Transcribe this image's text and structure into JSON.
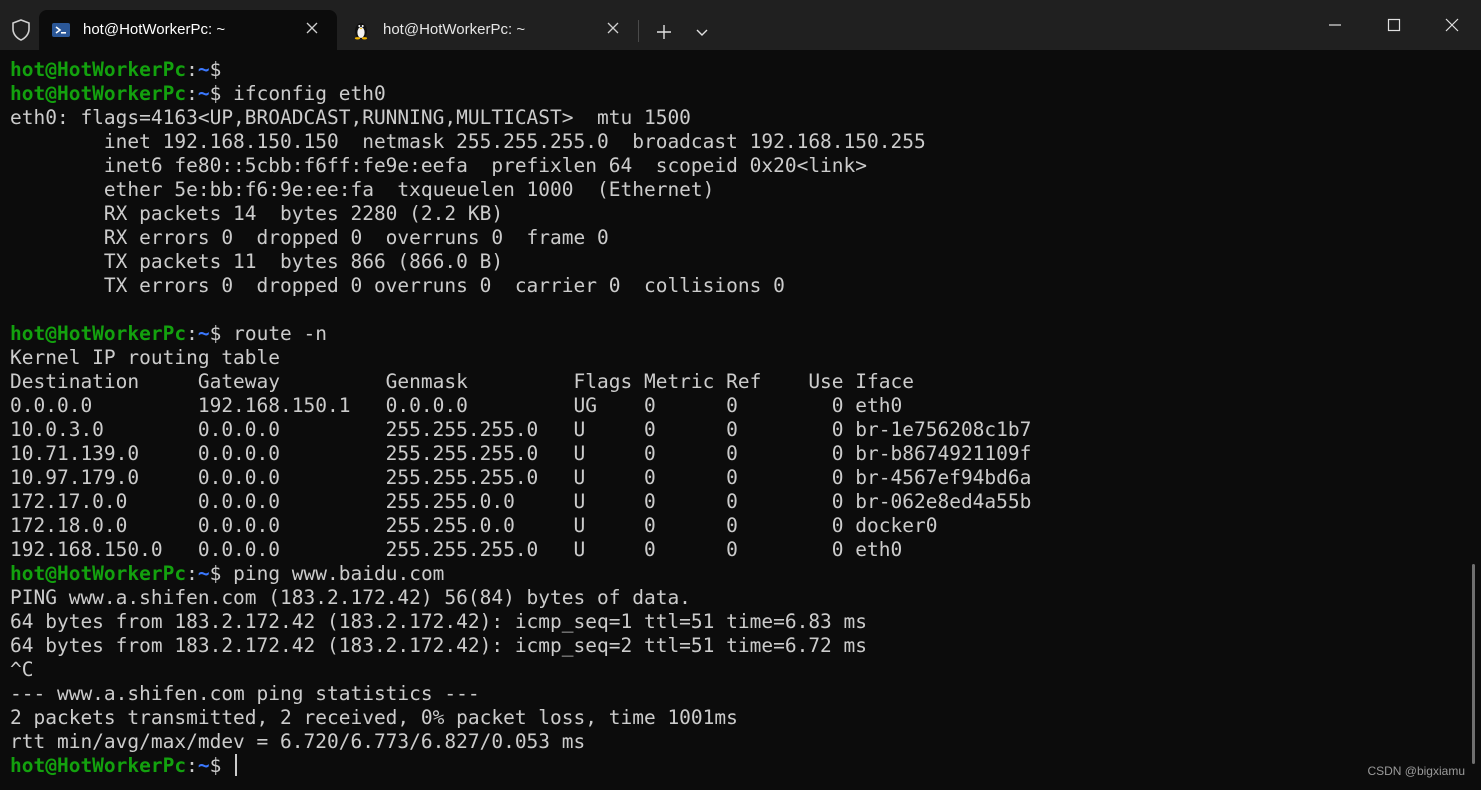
{
  "window": {
    "tabs": [
      {
        "label": "hot@HotWorkerPc: ~",
        "icon": "powershell-icon",
        "active": true
      },
      {
        "label": "hot@HotWorkerPc: ~",
        "icon": "linux-penguin-icon",
        "active": false
      }
    ],
    "controls": [
      "minimize-icon",
      "maximize-icon",
      "close-icon"
    ]
  },
  "prompt": {
    "user": "hot@HotWorkerPc",
    "colon": ":",
    "path": "~",
    "symbol": "$"
  },
  "lines": [
    {
      "type": "prompt",
      "cmd": ""
    },
    {
      "type": "prompt",
      "cmd": "ifconfig eth0"
    },
    {
      "type": "out",
      "text": "eth0: flags=4163<UP,BROADCAST,RUNNING,MULTICAST>  mtu 1500"
    },
    {
      "type": "out",
      "text": "        inet 192.168.150.150  netmask 255.255.255.0  broadcast 192.168.150.255"
    },
    {
      "type": "out",
      "text": "        inet6 fe80::5cbb:f6ff:fe9e:eefa  prefixlen 64  scopeid 0x20<link>"
    },
    {
      "type": "out",
      "text": "        ether 5e:bb:f6:9e:ee:fa  txqueuelen 1000  (Ethernet)"
    },
    {
      "type": "out",
      "text": "        RX packets 14  bytes 2280 (2.2 KB)"
    },
    {
      "type": "out",
      "text": "        RX errors 0  dropped 0  overruns 0  frame 0"
    },
    {
      "type": "out",
      "text": "        TX packets 11  bytes 866 (866.0 B)"
    },
    {
      "type": "out",
      "text": "        TX errors 0  dropped 0 overruns 0  carrier 0  collisions 0"
    },
    {
      "type": "out",
      "text": ""
    },
    {
      "type": "prompt",
      "cmd": "route -n"
    },
    {
      "type": "out",
      "text": "Kernel IP routing table"
    },
    {
      "type": "out",
      "text": "Destination     Gateway         Genmask         Flags Metric Ref    Use Iface"
    },
    {
      "type": "out",
      "text": "0.0.0.0         192.168.150.1   0.0.0.0         UG    0      0        0 eth0"
    },
    {
      "type": "out",
      "text": "10.0.3.0        0.0.0.0         255.255.255.0   U     0      0        0 br-1e756208c1b7"
    },
    {
      "type": "out",
      "text": "10.71.139.0     0.0.0.0         255.255.255.0   U     0      0        0 br-b8674921109f"
    },
    {
      "type": "out",
      "text": "10.97.179.0     0.0.0.0         255.255.255.0   U     0      0        0 br-4567ef94bd6a"
    },
    {
      "type": "out",
      "text": "172.17.0.0      0.0.0.0         255.255.0.0     U     0      0        0 br-062e8ed4a55b"
    },
    {
      "type": "out",
      "text": "172.18.0.0      0.0.0.0         255.255.0.0     U     0      0        0 docker0"
    },
    {
      "type": "out",
      "text": "192.168.150.0   0.0.0.0         255.255.255.0   U     0      0        0 eth0"
    },
    {
      "type": "prompt",
      "cmd": "ping www.baidu.com"
    },
    {
      "type": "out",
      "text": "PING www.a.shifen.com (183.2.172.42) 56(84) bytes of data."
    },
    {
      "type": "out",
      "text": "64 bytes from 183.2.172.42 (183.2.172.42): icmp_seq=1 ttl=51 time=6.83 ms"
    },
    {
      "type": "out",
      "text": "64 bytes from 183.2.172.42 (183.2.172.42): icmp_seq=2 ttl=51 time=6.72 ms"
    },
    {
      "type": "out",
      "text": "^C"
    },
    {
      "type": "out",
      "text": "--- www.a.shifen.com ping statistics ---"
    },
    {
      "type": "out",
      "text": "2 packets transmitted, 2 received, 0% packet loss, time 1001ms"
    },
    {
      "type": "out",
      "text": "rtt min/avg/max/mdev = 6.720/6.773/6.827/0.053 ms"
    },
    {
      "type": "prompt",
      "cmd": "",
      "cursor": true
    }
  ],
  "watermark": "CSDN @bigxiamu",
  "colors": {
    "prompt_user": "#13a10e",
    "prompt_path": "#3b78ff",
    "text": "#cccccc",
    "background": "#0c0c0c",
    "titlebar": "#202020"
  }
}
